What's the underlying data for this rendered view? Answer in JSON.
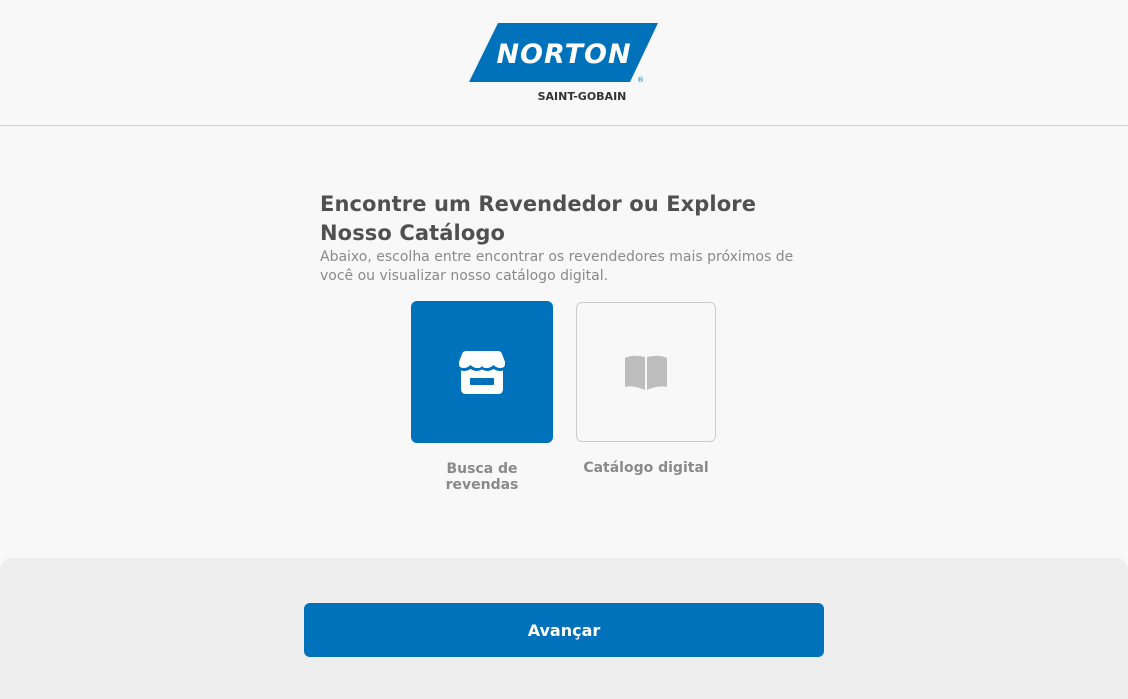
{
  "brand": {
    "name": "NORTON",
    "sub": "SAINT-GOBAIN",
    "registered": "®",
    "color": "#0071bb"
  },
  "main": {
    "title": "Encontre um Revendedor ou Explore Nosso Catálogo",
    "description": "Abaixo, escolha entre encontrar os revendedores mais próximos de você ou visualizar nosso catálogo digital.",
    "options": [
      {
        "label": "Busca de revendas",
        "icon": "store-icon",
        "selected": true
      },
      {
        "label": "Catálogo digital",
        "icon": "book-icon",
        "selected": false
      }
    ]
  },
  "footer": {
    "next_label": "Avançar"
  },
  "colors": {
    "accent": "#0071bb",
    "background": "#f8f8f8",
    "footer_bg": "#ededed",
    "muted_text": "#8a8a8a",
    "heading_text": "#505050"
  }
}
